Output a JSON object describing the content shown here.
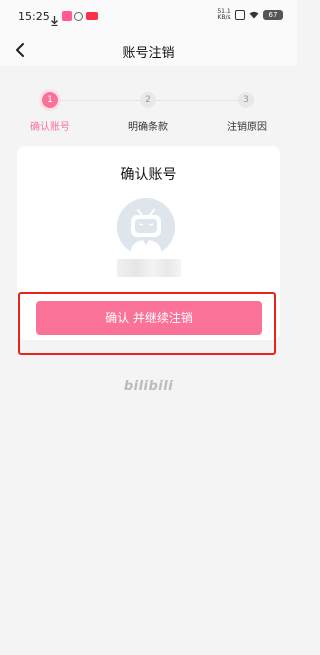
{
  "status_bar": {
    "time": "15:25",
    "net_speed_value": "51.1",
    "net_speed_unit": "KB/s",
    "battery": "67"
  },
  "nav": {
    "title": "账号注销"
  },
  "steps": [
    {
      "number": "1",
      "label": "确认账号",
      "active": true
    },
    {
      "number": "2",
      "label": "明确条款",
      "active": false
    },
    {
      "number": "3",
      "label": "注销原因",
      "active": false
    }
  ],
  "card": {
    "title": "确认账号",
    "confirm_button": "确认 并继续注销"
  },
  "brand": {
    "logo_text": "bilibili"
  },
  "colors": {
    "accent": "#fb7299",
    "highlight": "#e8241b",
    "background": "#f4f4f4"
  }
}
